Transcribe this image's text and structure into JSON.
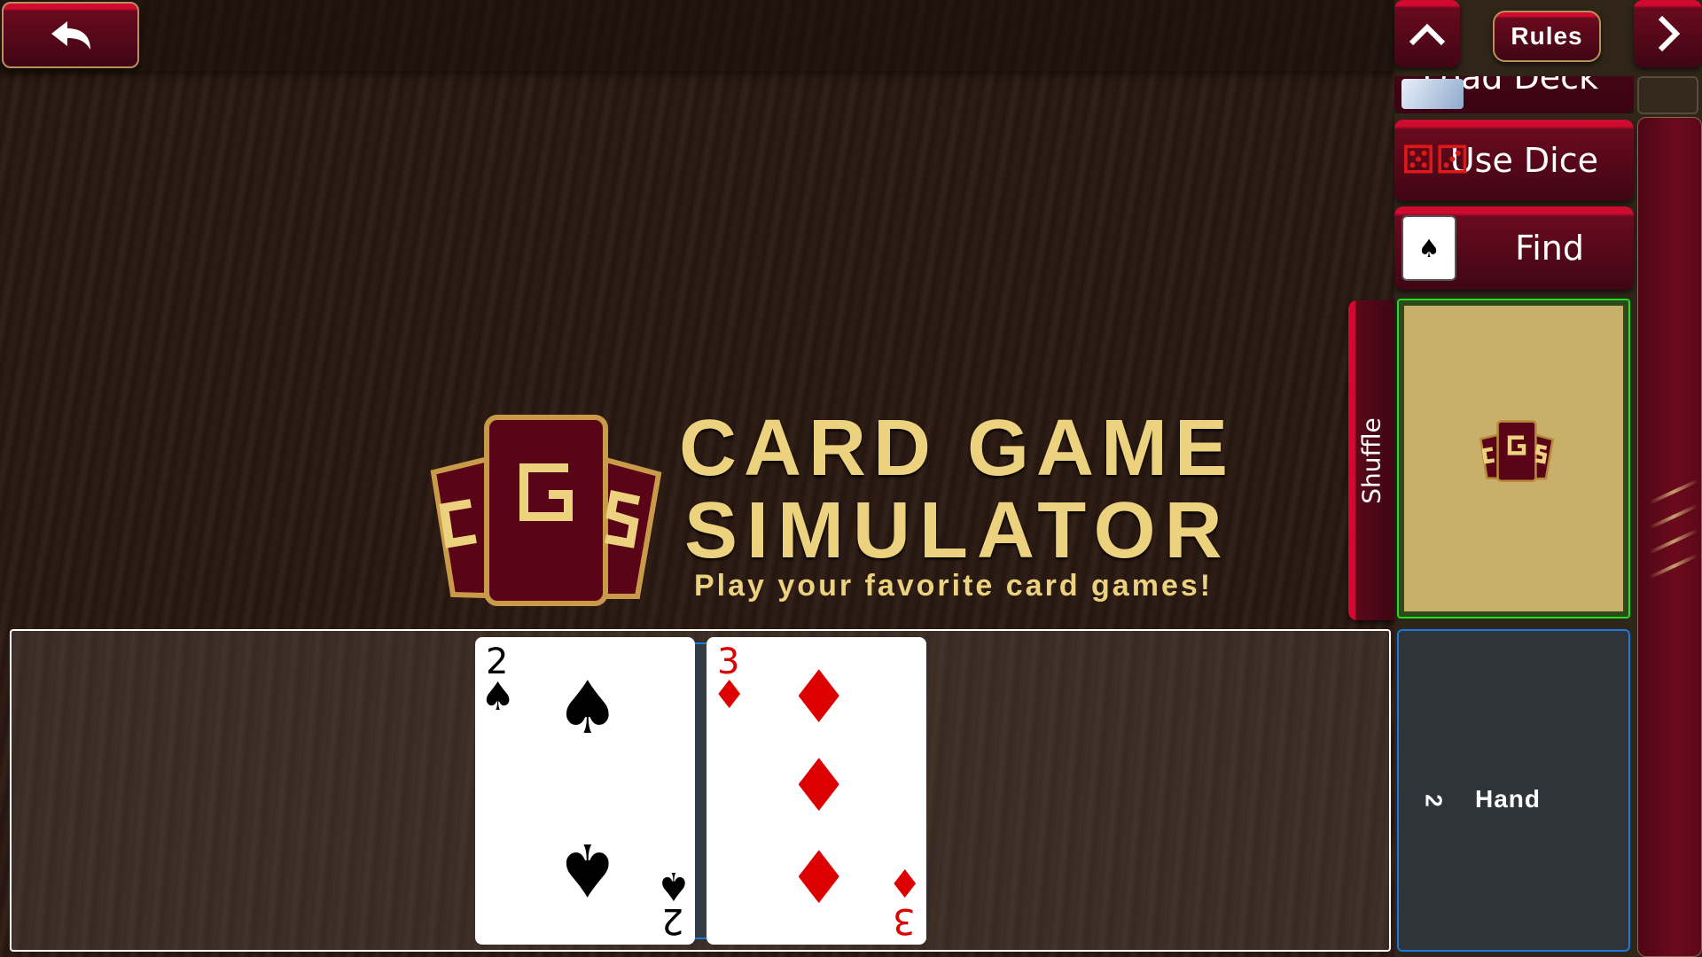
{
  "toolbar": {
    "back_icon": "back-arrow-icon",
    "up_icon": "chevron-up-icon",
    "rules_label": "Rules",
    "next_icon": "chevron-right-icon"
  },
  "menu": {
    "load_deck": "Load Deck",
    "use_dice": "Use Dice",
    "find": "Find"
  },
  "zones": {
    "shuffle_label": "Shuffle",
    "hand_label": "Hand",
    "hand_count": "2"
  },
  "logo": {
    "line1": "CARD GAME",
    "line2": "SIMULATOR",
    "tagline": "Play your favorite card games!",
    "mark": "CGS"
  },
  "cards": [
    {
      "rank": "2",
      "suit": "♠",
      "color": "#000000"
    },
    {
      "rank": "3",
      "suit": "♦",
      "color": "#dd0000"
    }
  ],
  "colors": {
    "accent_red": "#d10a30",
    "deck_border": "#1fe01f",
    "hand_border": "#1a7ae0",
    "gold": "#ecd27e"
  }
}
